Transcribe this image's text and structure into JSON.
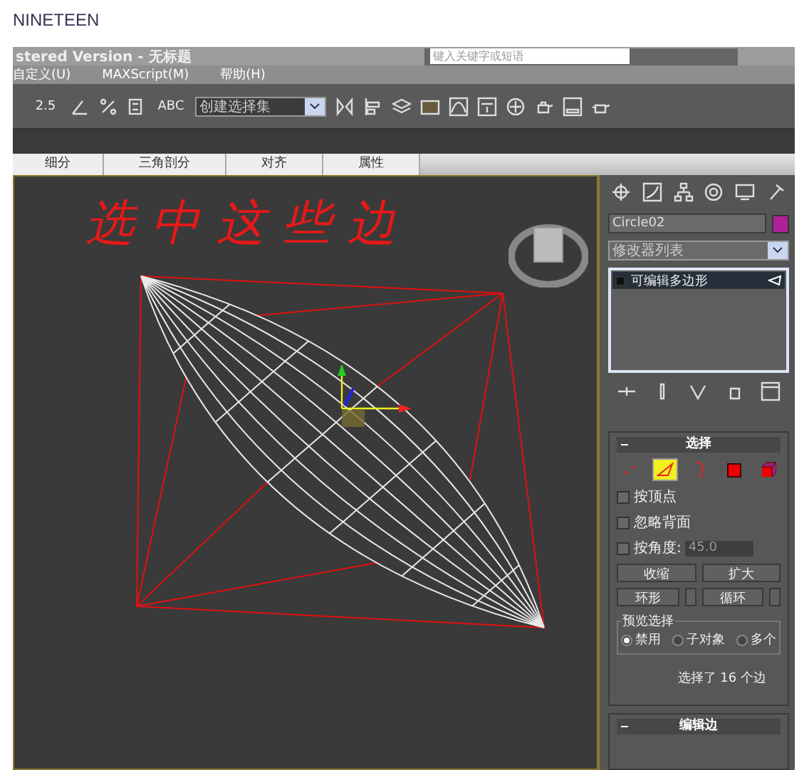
{
  "page_title": "NINETEEN",
  "window": {
    "title": "stered Version - 无标题",
    "search": {
      "placeholder": "键入关键字或短语"
    }
  },
  "menu": [
    "自定义(U)",
    "MAXScript(M)",
    "帮助(H)"
  ],
  "toolbar": {
    "snap_label": "2.5",
    "text_label": "ABC",
    "named_selection": "创建选择集"
  },
  "ribbon_tabs": [
    "细分",
    "三角剖分",
    "对齐",
    "属性"
  ],
  "viewport": {
    "annotation": "选中这些边"
  },
  "command_panel": {
    "object_name": "Circle02",
    "modifier_list": "修改器列表",
    "stack": [
      {
        "label": "可编辑多边形",
        "selected": true
      }
    ],
    "selection": {
      "title": "选择",
      "levels": [
        {
          "kind": "vertex",
          "selected": false
        },
        {
          "kind": "edge",
          "selected": true
        },
        {
          "kind": "border",
          "selected": false
        },
        {
          "kind": "polygon",
          "selected": false
        },
        {
          "kind": "element",
          "selected": false
        }
      ],
      "options": [
        {
          "label": "按顶点",
          "checked": false
        },
        {
          "label": "忽略背面",
          "checked": false
        },
        {
          "label": "按角度:",
          "checked": false,
          "value": "45.0"
        }
      ],
      "buttons": [
        "收缩",
        "扩大"
      ],
      "spinner_buttons": [
        "环形",
        "循环"
      ],
      "preview": {
        "title": "预览选择",
        "options": [
          {
            "label": "禁用",
            "selected": true
          },
          {
            "label": "子对象",
            "selected": false
          },
          {
            "label": "多个",
            "selected": false
          }
        ]
      },
      "status": "选择了 16 个边"
    },
    "edit_edges": {
      "title": "编辑边"
    }
  }
}
